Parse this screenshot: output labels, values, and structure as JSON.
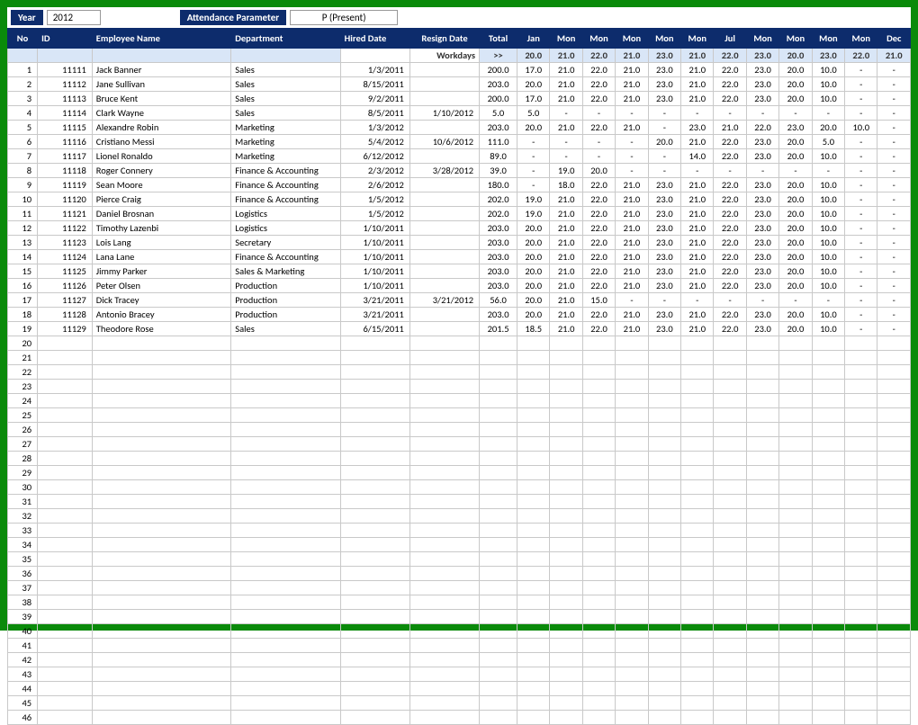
{
  "topbar": {
    "year_label": "Year",
    "year_value": "2012",
    "param_label": "Attendance Parameter",
    "param_value": "P (Present)"
  },
  "headers": {
    "no": "No",
    "id": "ID",
    "name": "Employee Name",
    "dept": "Department",
    "hired": "Hired Date",
    "resign": "Resign Date",
    "total": "Total",
    "months": [
      "Jan",
      "Mon",
      "Mon",
      "Mon",
      "Mon",
      "Mon",
      "Jul",
      "Mon",
      "Mon",
      "Mon",
      "Mon",
      "Dec"
    ]
  },
  "subheader": {
    "label": "Workdays",
    "arrow": ">>",
    "values": [
      "20.0",
      "21.0",
      "22.0",
      "21.0",
      "23.0",
      "21.0",
      "22.0",
      "23.0",
      "20.0",
      "23.0",
      "22.0",
      "21.0"
    ]
  },
  "rows": [
    {
      "no": "1",
      "id": "11111",
      "name": "Jack Banner",
      "dept": "Sales",
      "hired": "1/3/2011",
      "resign": "",
      "total": "200.0",
      "m": [
        "17.0",
        "21.0",
        "22.0",
        "21.0",
        "23.0",
        "21.0",
        "22.0",
        "23.0",
        "20.0",
        "10.0",
        "-",
        "-"
      ]
    },
    {
      "no": "2",
      "id": "11112",
      "name": "Jane Sullivan",
      "dept": "Sales",
      "hired": "8/15/2011",
      "resign": "",
      "total": "203.0",
      "m": [
        "20.0",
        "21.0",
        "22.0",
        "21.0",
        "23.0",
        "21.0",
        "22.0",
        "23.0",
        "20.0",
        "10.0",
        "-",
        "-"
      ]
    },
    {
      "no": "3",
      "id": "11113",
      "name": "Bruce Kent",
      "dept": "Sales",
      "hired": "9/2/2011",
      "resign": "",
      "total": "200.0",
      "m": [
        "17.0",
        "21.0",
        "22.0",
        "21.0",
        "23.0",
        "21.0",
        "22.0",
        "23.0",
        "20.0",
        "10.0",
        "-",
        "-"
      ]
    },
    {
      "no": "4",
      "id": "11114",
      "name": "Clark Wayne",
      "dept": "Sales",
      "hired": "8/5/2011",
      "resign": "1/10/2012",
      "total": "5.0",
      "m": [
        "5.0",
        "-",
        "-",
        "-",
        "-",
        "-",
        "-",
        "-",
        "-",
        "-",
        "-",
        "-"
      ]
    },
    {
      "no": "5",
      "id": "11115",
      "name": "Alexandre Robin",
      "dept": "Marketing",
      "hired": "1/3/2012",
      "resign": "",
      "total": "203.0",
      "m": [
        "20.0",
        "21.0",
        "22.0",
        "21.0",
        "-",
        "23.0",
        "21.0",
        "22.0",
        "23.0",
        "20.0",
        "10.0",
        "-"
      ]
    },
    {
      "no": "6",
      "id": "11116",
      "name": "Cristiano Messi",
      "dept": "Marketing",
      "hired": "5/4/2012",
      "resign": "10/6/2012",
      "total": "111.0",
      "m": [
        "-",
        "-",
        "-",
        "-",
        "20.0",
        "21.0",
        "22.0",
        "23.0",
        "20.0",
        "5.0",
        "-",
        "-"
      ]
    },
    {
      "no": "7",
      "id": "11117",
      "name": "Lionel Ronaldo",
      "dept": "Marketing",
      "hired": "6/12/2012",
      "resign": "",
      "total": "89.0",
      "m": [
        "-",
        "-",
        "-",
        "-",
        "-",
        "14.0",
        "22.0",
        "23.0",
        "20.0",
        "10.0",
        "-",
        "-"
      ]
    },
    {
      "no": "8",
      "id": "11118",
      "name": "Roger Connery",
      "dept": "Finance & Accounting",
      "hired": "2/3/2012",
      "resign": "3/28/2012",
      "total": "39.0",
      "m": [
        "-",
        "19.0",
        "20.0",
        "-",
        "-",
        "-",
        "-",
        "-",
        "-",
        "-",
        "-",
        "-"
      ]
    },
    {
      "no": "9",
      "id": "11119",
      "name": "Sean Moore",
      "dept": "Finance & Accounting",
      "hired": "2/6/2012",
      "resign": "",
      "total": "180.0",
      "m": [
        "-",
        "18.0",
        "22.0",
        "21.0",
        "23.0",
        "21.0",
        "22.0",
        "23.0",
        "20.0",
        "10.0",
        "-",
        "-"
      ]
    },
    {
      "no": "10",
      "id": "11120",
      "name": "Pierce Craig",
      "dept": "Finance & Accounting",
      "hired": "1/5/2012",
      "resign": "",
      "total": "202.0",
      "m": [
        "19.0",
        "21.0",
        "22.0",
        "21.0",
        "23.0",
        "21.0",
        "22.0",
        "23.0",
        "20.0",
        "10.0",
        "-",
        "-"
      ]
    },
    {
      "no": "11",
      "id": "11121",
      "name": "Daniel Brosnan",
      "dept": "Logistics",
      "hired": "1/5/2012",
      "resign": "",
      "total": "202.0",
      "m": [
        "19.0",
        "21.0",
        "22.0",
        "21.0",
        "23.0",
        "21.0",
        "22.0",
        "23.0",
        "20.0",
        "10.0",
        "-",
        "-"
      ]
    },
    {
      "no": "12",
      "id": "11122",
      "name": "Timothy Lazenbi",
      "dept": "Logistics",
      "hired": "1/10/2011",
      "resign": "",
      "total": "203.0",
      "m": [
        "20.0",
        "21.0",
        "22.0",
        "21.0",
        "23.0",
        "21.0",
        "22.0",
        "23.0",
        "20.0",
        "10.0",
        "-",
        "-"
      ]
    },
    {
      "no": "13",
      "id": "11123",
      "name": "Lois Lang",
      "dept": "Secretary",
      "hired": "1/10/2011",
      "resign": "",
      "total": "203.0",
      "m": [
        "20.0",
        "21.0",
        "22.0",
        "21.0",
        "23.0",
        "21.0",
        "22.0",
        "23.0",
        "20.0",
        "10.0",
        "-",
        "-"
      ]
    },
    {
      "no": "14",
      "id": "11124",
      "name": "Lana Lane",
      "dept": "Finance & Accounting",
      "hired": "1/10/2011",
      "resign": "",
      "total": "203.0",
      "m": [
        "20.0",
        "21.0",
        "22.0",
        "21.0",
        "23.0",
        "21.0",
        "22.0",
        "23.0",
        "20.0",
        "10.0",
        "-",
        "-"
      ]
    },
    {
      "no": "15",
      "id": "11125",
      "name": "Jimmy Parker",
      "dept": "Sales & Marketing",
      "hired": "1/10/2011",
      "resign": "",
      "total": "203.0",
      "m": [
        "20.0",
        "21.0",
        "22.0",
        "21.0",
        "23.0",
        "21.0",
        "22.0",
        "23.0",
        "20.0",
        "10.0",
        "-",
        "-"
      ]
    },
    {
      "no": "16",
      "id": "11126",
      "name": "Peter Olsen",
      "dept": "Production",
      "hired": "1/10/2011",
      "resign": "",
      "total": "203.0",
      "m": [
        "20.0",
        "21.0",
        "22.0",
        "21.0",
        "23.0",
        "21.0",
        "22.0",
        "23.0",
        "20.0",
        "10.0",
        "-",
        "-"
      ]
    },
    {
      "no": "17",
      "id": "11127",
      "name": "Dick Tracey",
      "dept": "Production",
      "hired": "3/21/2011",
      "resign": "3/21/2012",
      "total": "56.0",
      "m": [
        "20.0",
        "21.0",
        "15.0",
        "-",
        "-",
        "-",
        "-",
        "-",
        "-",
        "-",
        "-",
        "-"
      ]
    },
    {
      "no": "18",
      "id": "11128",
      "name": "Antonio Bracey",
      "dept": "Production",
      "hired": "3/21/2011",
      "resign": "",
      "total": "203.0",
      "m": [
        "20.0",
        "21.0",
        "22.0",
        "21.0",
        "23.0",
        "21.0",
        "22.0",
        "23.0",
        "20.0",
        "10.0",
        "-",
        "-"
      ]
    },
    {
      "no": "19",
      "id": "11129",
      "name": "Theodore Rose",
      "dept": "Sales",
      "hired": "6/15/2011",
      "resign": "",
      "total": "201.5",
      "m": [
        "18.5",
        "21.0",
        "22.0",
        "21.0",
        "23.0",
        "21.0",
        "22.0",
        "23.0",
        "20.0",
        "10.0",
        "-",
        "-"
      ]
    }
  ],
  "empty_rows_start": 20,
  "empty_rows_end": 46
}
